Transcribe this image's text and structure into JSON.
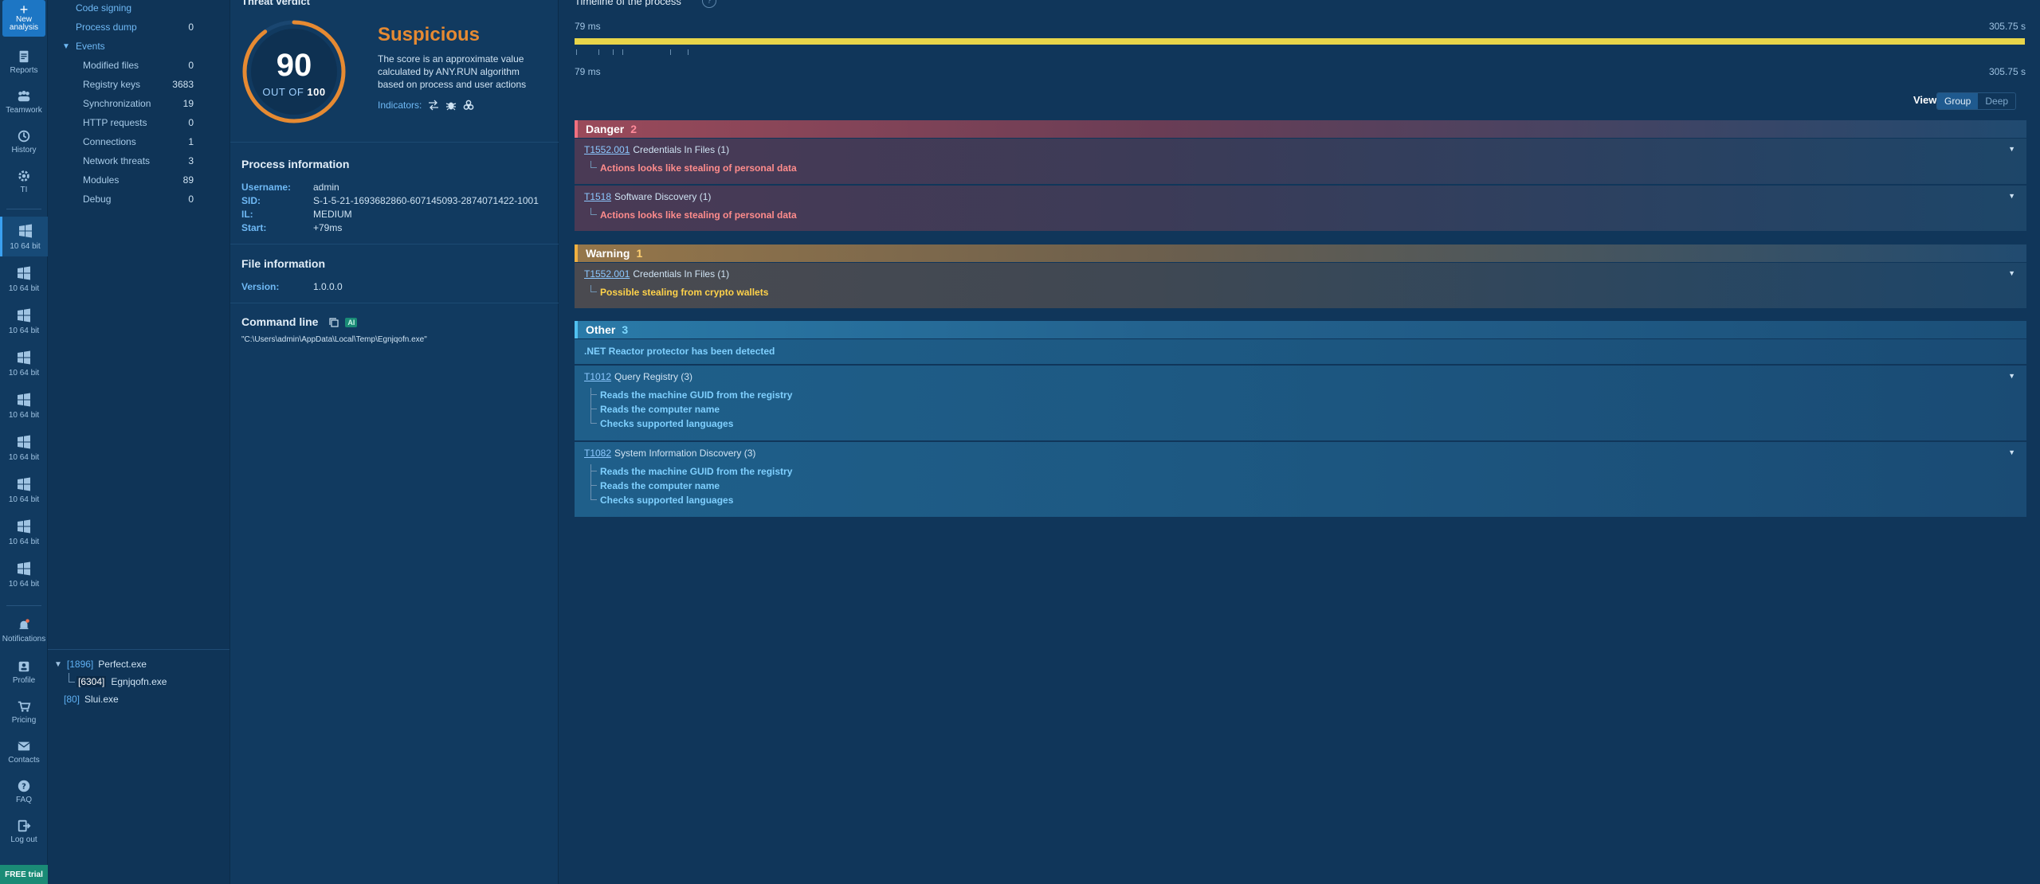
{
  "rail": {
    "new_analysis": "New analysis",
    "reports": "Reports",
    "teamwork": "Teamwork",
    "history": "History",
    "ti": "TI",
    "os_items": [
      "10 64 bit",
      "10 64 bit",
      "10 64 bit",
      "10 64 bit",
      "10 64 bit",
      "10 64 bit",
      "10 64 bit",
      "10 64 bit",
      "10 64 bit"
    ],
    "notifications": "Notifications",
    "profile": "Profile",
    "pricing": "Pricing",
    "contacts": "Contacts",
    "faq": "FAQ",
    "logout": "Log out",
    "free_trial": "FREE trial"
  },
  "events": {
    "code_signing": "Code signing",
    "process_dump": {
      "label": "Process dump",
      "value": "0"
    },
    "events_label": "Events",
    "items": [
      {
        "label": "Modified files",
        "value": "0"
      },
      {
        "label": "Registry keys",
        "value": "3683"
      },
      {
        "label": "Synchronization",
        "value": "19"
      },
      {
        "label": "HTTP requests",
        "value": "0"
      },
      {
        "label": "Connections",
        "value": "1"
      },
      {
        "label": "Network threats",
        "value": "3"
      },
      {
        "label": "Modules",
        "value": "89"
      },
      {
        "label": "Debug",
        "value": "0"
      }
    ]
  },
  "processes": [
    {
      "pid": "[1896]",
      "name": "Perfect.exe"
    },
    {
      "pid": "[6304]",
      "name": "Egnjqofn.exe"
    },
    {
      "pid": "[80]",
      "name": "Slui.exe"
    }
  ],
  "verdict": {
    "title": "Threat verdict",
    "score": "90",
    "out_of_label": "OUT OF",
    "out_of_value": "100",
    "score_fraction": 0.9,
    "word": "Suspicious",
    "description": "The score is an approximate value calculated by ANY.RUN algorithm based on process and user actions",
    "indicators_label": "Indicators:"
  },
  "process_info": {
    "title": "Process information",
    "rows": [
      {
        "k": "Username:",
        "v": "admin"
      },
      {
        "k": "SID:",
        "v": "S-1-5-21-1693682860-607145093-2874071422-1001"
      },
      {
        "k": "IL:",
        "v": "MEDIUM"
      },
      {
        "k": "Start:",
        "v": "+79ms"
      }
    ]
  },
  "file_info": {
    "title": "File information",
    "rows": [
      {
        "k": "Version:",
        "v": "1.0.0.0"
      }
    ]
  },
  "command_line": {
    "title": "Command line",
    "ai": "AI",
    "text": "\"C:\\Users\\admin\\AppData\\Local\\Temp\\Egnjqofn.exe\""
  },
  "timeline": {
    "title": "Timeline of the process",
    "help": "?",
    "start_top": "79 ms",
    "end_top": "305.75 s",
    "start_bottom": "79 ms",
    "end_bottom": "305.75 s"
  },
  "view": {
    "label": "View",
    "options": [
      "Group",
      "Deep"
    ],
    "selected": "Group"
  },
  "groups": {
    "danger": {
      "label": "Danger",
      "count": "2"
    },
    "warning": {
      "label": "Warning",
      "count": "1"
    },
    "other": {
      "label": "Other",
      "count": "3"
    }
  },
  "danger_cards": [
    {
      "id": "T1552.001",
      "name": "Credentials In Files (1)",
      "subs": [
        "Actions looks like stealing of personal data"
      ]
    },
    {
      "id": "T1518",
      "name": "Software Discovery (1)",
      "subs": [
        "Actions looks like stealing of personal data"
      ]
    }
  ],
  "warning_cards": [
    {
      "id": "T1552.001",
      "name": "Credentials In Files (1)",
      "subs": [
        "Possible stealing from crypto wallets"
      ]
    }
  ],
  "other_plain": ".NET Reactor protector has been detected",
  "other_cards": [
    {
      "id": "T1012",
      "name": "Query Registry (3)",
      "subs": [
        "Reads the machine GUID from the registry",
        "Reads the computer name",
        "Checks supported languages"
      ]
    },
    {
      "id": "T1082",
      "name": "System Information Discovery (3)",
      "subs": [
        "Reads the machine GUID from the registry",
        "Reads the computer name",
        "Checks supported languages"
      ]
    }
  ],
  "colors": {
    "accent": "#1d76c4",
    "suspicious": "#e68a32",
    "danger": "#f07080",
    "warning": "#f0b040",
    "other": "#50c0f0",
    "timeline_bar": "#e8d54a"
  }
}
